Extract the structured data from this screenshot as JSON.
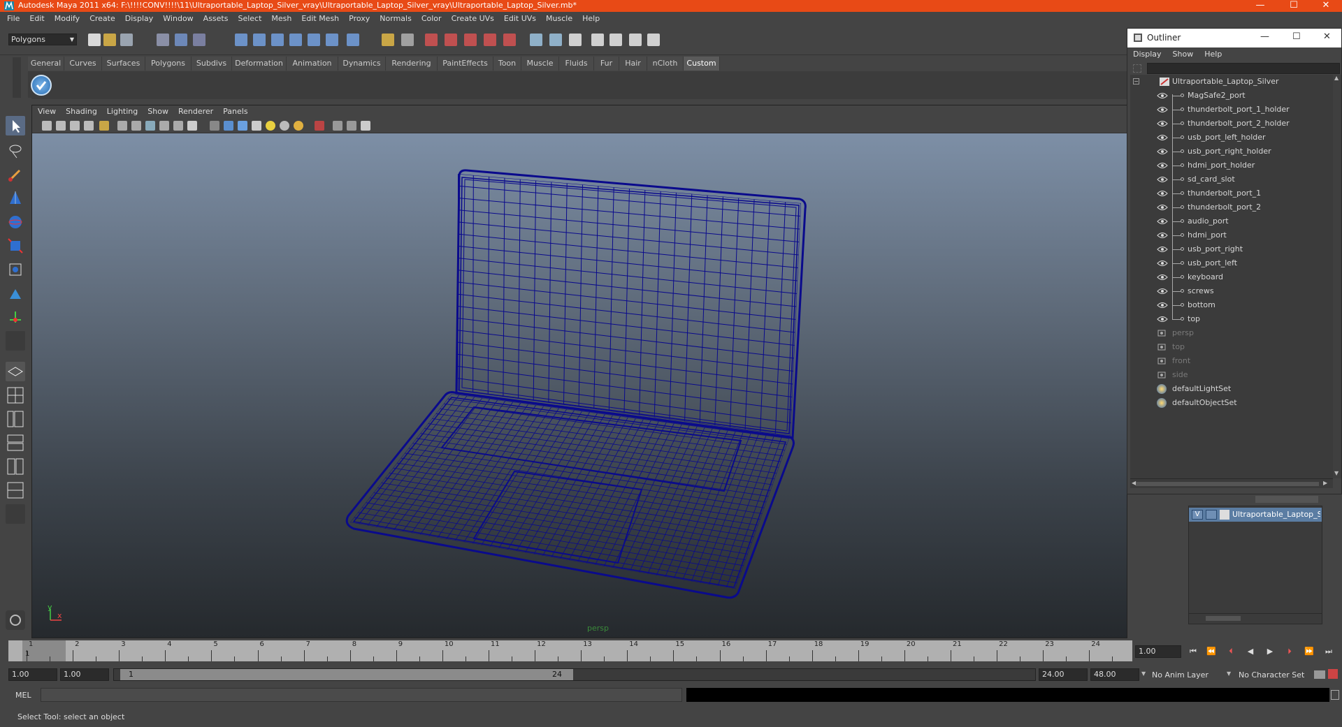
{
  "window": {
    "title": "Autodesk Maya 2011 x64: F:\\!!!!CONV!!!!\\11\\Ultraportable_Laptop_Silver_vray\\Ultraportable_Laptop_Silver_vray\\Ultraportable_Laptop_Silver.mb*",
    "minimize": "—",
    "maximize": "☐",
    "close": "✕"
  },
  "menubar": [
    "File",
    "Edit",
    "Modify",
    "Create",
    "Display",
    "Window",
    "Assets",
    "Select",
    "Mesh",
    "Edit Mesh",
    "Proxy",
    "Normals",
    "Color",
    "Create UVs",
    "Edit UVs",
    "Muscle",
    "Help"
  ],
  "toolbar": {
    "mode": "Polygons"
  },
  "shelf": {
    "tabs": [
      "General",
      "Curves",
      "Surfaces",
      "Polygons",
      "Subdivs",
      "Deformation",
      "Animation",
      "Dynamics",
      "Rendering",
      "PaintEffects",
      "Toon",
      "Muscle",
      "Fluids",
      "Fur",
      "Hair",
      "nCloth",
      "Custom"
    ],
    "active": "Custom"
  },
  "viewport": {
    "menu": [
      "View",
      "Shading",
      "Lighting",
      "Show",
      "Renderer",
      "Panels"
    ],
    "camera_label": "persp",
    "axis_y": "y",
    "axis_x": "x"
  },
  "outliner": {
    "title": "Outliner",
    "menu": [
      "Display",
      "Show",
      "Help"
    ],
    "root": "Ultraportable_Laptop_Silver",
    "children": [
      "MagSafe2_port",
      "thunderbolt_port_1_holder",
      "thunderbolt_port_2_holder",
      "usb_port_left_holder",
      "usb_port_right_holder",
      "hdmi_port_holder",
      "sd_card_slot",
      "thunderbolt_port_1",
      "thunderbolt_port_2",
      "audio_port",
      "hdmi_port",
      "usb_port_right",
      "usb_port_left",
      "keyboard",
      "screws",
      "bottom",
      "top"
    ],
    "cameras": [
      "persp",
      "top",
      "front",
      "side"
    ],
    "sets": [
      "defaultLightSet",
      "defaultObjectSet"
    ]
  },
  "layer": {
    "visible": "V",
    "name": "Ultraportable_Laptop_Silver"
  },
  "timeline": {
    "ticks": [
      "1",
      "2",
      "3",
      "4",
      "5",
      "6",
      "7",
      "8",
      "9",
      "10",
      "11",
      "12",
      "13",
      "14",
      "15",
      "16",
      "17",
      "18",
      "19",
      "20",
      "21",
      "22",
      "23",
      "24"
    ],
    "current_frame": "1.00",
    "current_marker": "1"
  },
  "range": {
    "start": "1.00",
    "playback_start": "1.00",
    "handle_start": "1",
    "handle_end": "24",
    "playback_end": "24.00",
    "end": "48.00",
    "anim_layer": "No Anim Layer",
    "character_set": "No Character Set"
  },
  "command": {
    "label": "MEL"
  },
  "helpline": {
    "text": "Select Tool: select an object"
  },
  "colors": {
    "titlebar": "#e84a16",
    "wireframe": "#0a0a8c",
    "layer_highlight": "#5b7da3"
  }
}
